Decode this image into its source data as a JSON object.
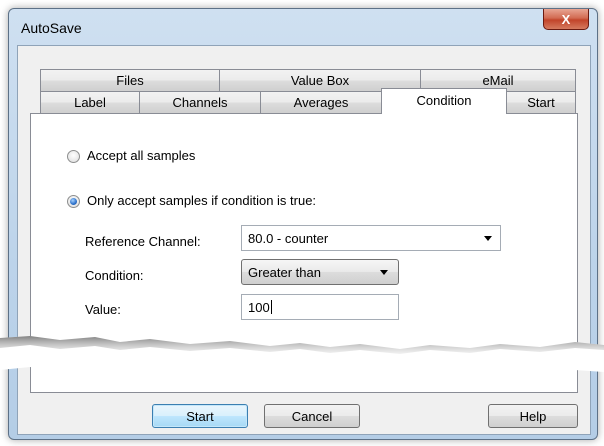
{
  "window": {
    "title": "AutoSave",
    "close_glyph": "X"
  },
  "tabs": {
    "row1": [
      "Files",
      "Value Box",
      "eMail"
    ],
    "row2": [
      "Label",
      "Channels",
      "Averages",
      "Condition",
      "Start"
    ],
    "active": "Condition"
  },
  "condition": {
    "accept_all_label": "Accept all samples",
    "accept_all_checked": false,
    "only_if_label": "Only accept samples if condition is true:",
    "only_if_checked": true,
    "reference_channel_label": "Reference Channel:",
    "reference_channel_value": "80.0 - counter",
    "condition_label": "Condition:",
    "condition_value": "Greater than",
    "value_label": "Value:",
    "value_value": "100"
  },
  "buttons": {
    "start": "Start",
    "cancel": "Cancel",
    "help": "Help"
  },
  "colors": {
    "accent": "#3c7fb1",
    "close": "#c2442a",
    "frame": "#bcd3ea"
  }
}
